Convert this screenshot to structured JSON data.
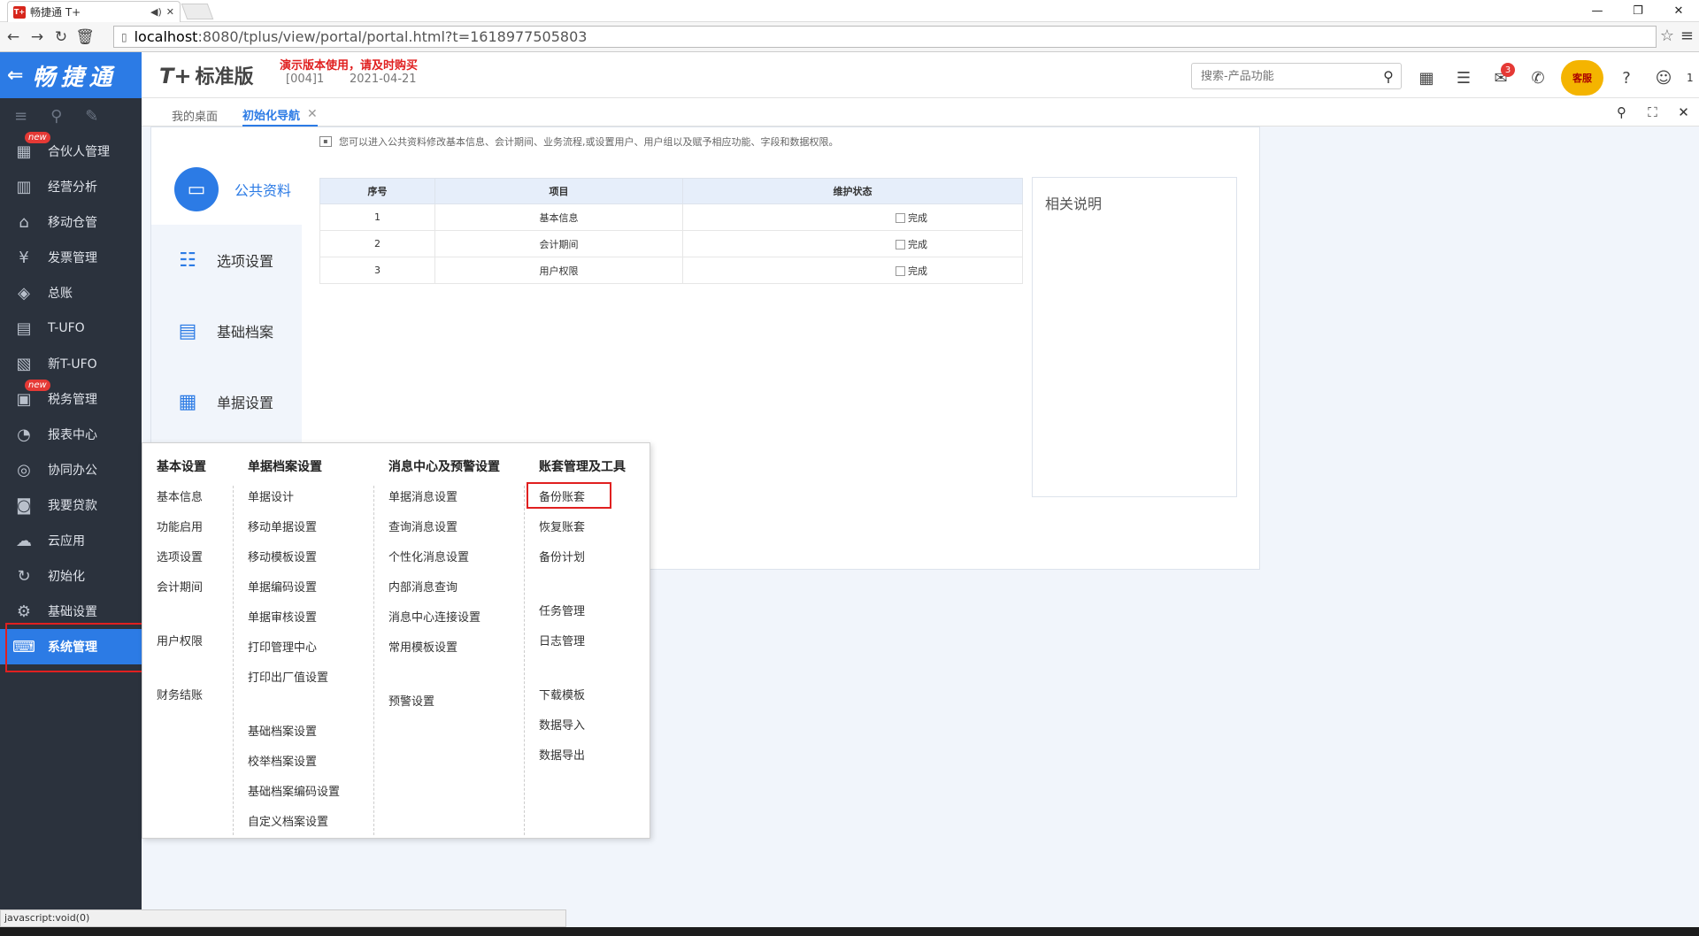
{
  "browser": {
    "tab_title": "畅捷通 T+",
    "favicon_text": "T+",
    "url_host": "localhost",
    "url_rest": ":8080/tplus/view/portal/portal.html?t=1618977505803",
    "status_text": "javascript:void(0)"
  },
  "header": {
    "brand": "畅捷通",
    "product": "T+",
    "edition": "标准版",
    "demo_notice": "演示版本使用，请及时购买",
    "account": "[004]1",
    "date": "2021-04-21",
    "search_placeholder": "搜索-产品功能",
    "notification_count": "3",
    "support_label": "客服",
    "user_label": "1"
  },
  "sidebar": {
    "items": [
      {
        "label": "合伙人管理",
        "icon": "partner-icon",
        "new": true
      },
      {
        "label": "经营分析",
        "icon": "analysis-icon"
      },
      {
        "label": "移动仓管",
        "icon": "mobile-warehouse-icon"
      },
      {
        "label": "发票管理",
        "icon": "invoice-icon"
      },
      {
        "label": "总账",
        "icon": "ledger-icon"
      },
      {
        "label": "T-UFO",
        "icon": "tufo-icon"
      },
      {
        "label": "新T-UFO",
        "icon": "new-tufo-icon"
      },
      {
        "label": "税务管理",
        "icon": "tax-icon",
        "new": true
      },
      {
        "label": "报表中心",
        "icon": "report-icon"
      },
      {
        "label": "协同办公",
        "icon": "collab-icon"
      },
      {
        "label": "我要贷款",
        "icon": "loan-icon"
      },
      {
        "label": "云应用",
        "icon": "cloud-icon"
      },
      {
        "label": "初始化",
        "icon": "init-icon"
      },
      {
        "label": "基础设置",
        "icon": "settings-icon"
      },
      {
        "label": "系统管理",
        "icon": "system-icon",
        "active": true
      }
    ],
    "new_badge": "new"
  },
  "tabs": [
    {
      "label": "我的桌面"
    },
    {
      "label": "初始化导航",
      "active": true
    }
  ],
  "init": {
    "tip": "您可以进入公共资料修改基本信息、会计期间、业务流程,或设置用户、用户组以及赋予相应功能、字段和数据权限。",
    "steps": [
      "公共资料",
      "选项设置",
      "基础档案",
      "单据设置"
    ],
    "table": {
      "headers": [
        "序号",
        "项目",
        "维护状态"
      ],
      "rows": [
        {
          "no": "1",
          "item": "基本信息",
          "status": "完成"
        },
        {
          "no": "2",
          "item": "会计期间",
          "status": "完成"
        },
        {
          "no": "3",
          "item": "用户权限",
          "status": "完成"
        }
      ]
    },
    "notes_title": "相关说明"
  },
  "menu": {
    "columns": [
      {
        "heading": "基本设置",
        "items": [
          "基本信息",
          "功能启用",
          "选项设置",
          "会计期间",
          "",
          "用户权限",
          "",
          "财务结账"
        ]
      },
      {
        "heading": "单据档案设置",
        "items": [
          "单据设计",
          "移动单据设置",
          "移动模板设置",
          "单据编码设置",
          "单据审核设置",
          "打印管理中心",
          "打印出厂值设置",
          "",
          "基础档案设置",
          "校举档案设置",
          "基础档案编码设置",
          "自定义档案设置"
        ]
      },
      {
        "heading": "消息中心及预警设置",
        "items": [
          "单据消息设置",
          "查询消息设置",
          "个性化消息设置",
          "内部消息查询",
          "消息中心连接设置",
          "常用模板设置",
          "",
          "预警设置"
        ]
      },
      {
        "heading": "账套管理及工具",
        "items": [
          "备份账套",
          "恢复账套",
          "备份计划",
          "",
          "任务管理",
          "日志管理",
          "",
          "下载模板",
          "数据导入",
          "数据导出"
        ]
      }
    ]
  },
  "colors": {
    "accent": "#2c7be5",
    "sidebar_bg": "#2b323d",
    "highlight": "#e02020"
  }
}
